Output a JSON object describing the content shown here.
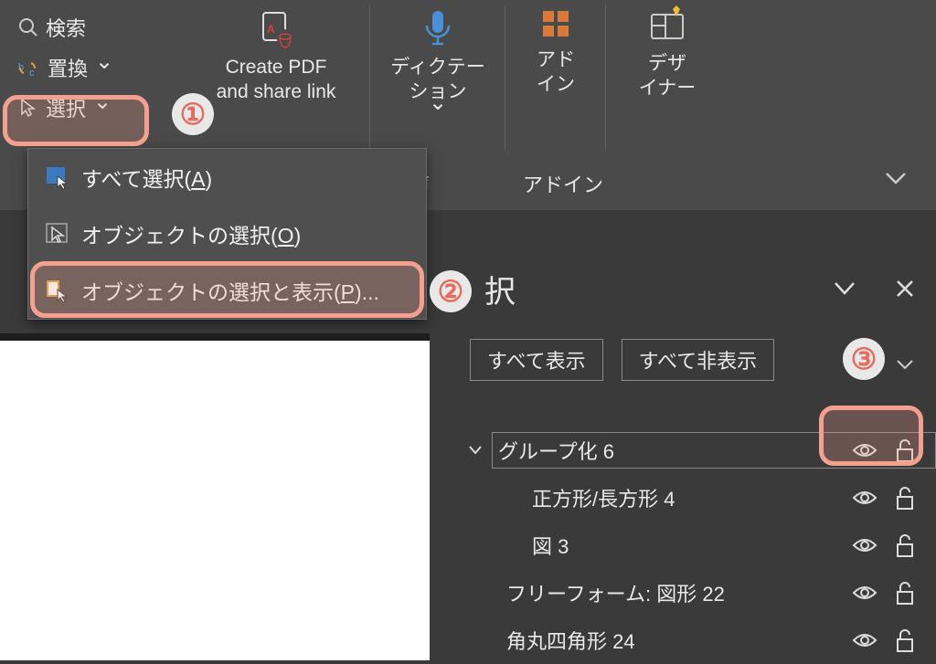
{
  "ribbon": {
    "search": "検索",
    "replace": "置換",
    "select": "選択",
    "pdf": "Create PDF\nand share link",
    "dictation": "ディクテー\nション",
    "addins": "アド\nイン",
    "designer": "デザ\nイナー",
    "group_voice": "声",
    "group_addins": "アドイン"
  },
  "menu": {
    "select_all_pre": "すべて選択(",
    "select_all_key": "A",
    "select_all_post": ")",
    "select_objects_pre": "オブジェクトの選択(",
    "select_objects_key": "O",
    "select_objects_post": ")",
    "selection_pane_pre": "オブジェクトの選択と表示(",
    "selection_pane_key": "P",
    "selection_pane_post": ")..."
  },
  "pane": {
    "title": "択",
    "show_all": "すべて表示",
    "hide_all": "すべて非表示",
    "items": [
      {
        "name": "グループ化 6",
        "selected": true,
        "indent": 0,
        "expander": true
      },
      {
        "name": "正方形/長方形 4",
        "selected": false,
        "indent": 1
      },
      {
        "name": "図 3",
        "selected": false,
        "indent": 1
      },
      {
        "name": "フリーフォーム: 図形 22",
        "selected": false,
        "indent": 0
      },
      {
        "name": "角丸四角形 24",
        "selected": false,
        "indent": 0
      }
    ]
  },
  "markers": {
    "1": "①",
    "2": "②",
    "3": "③"
  }
}
